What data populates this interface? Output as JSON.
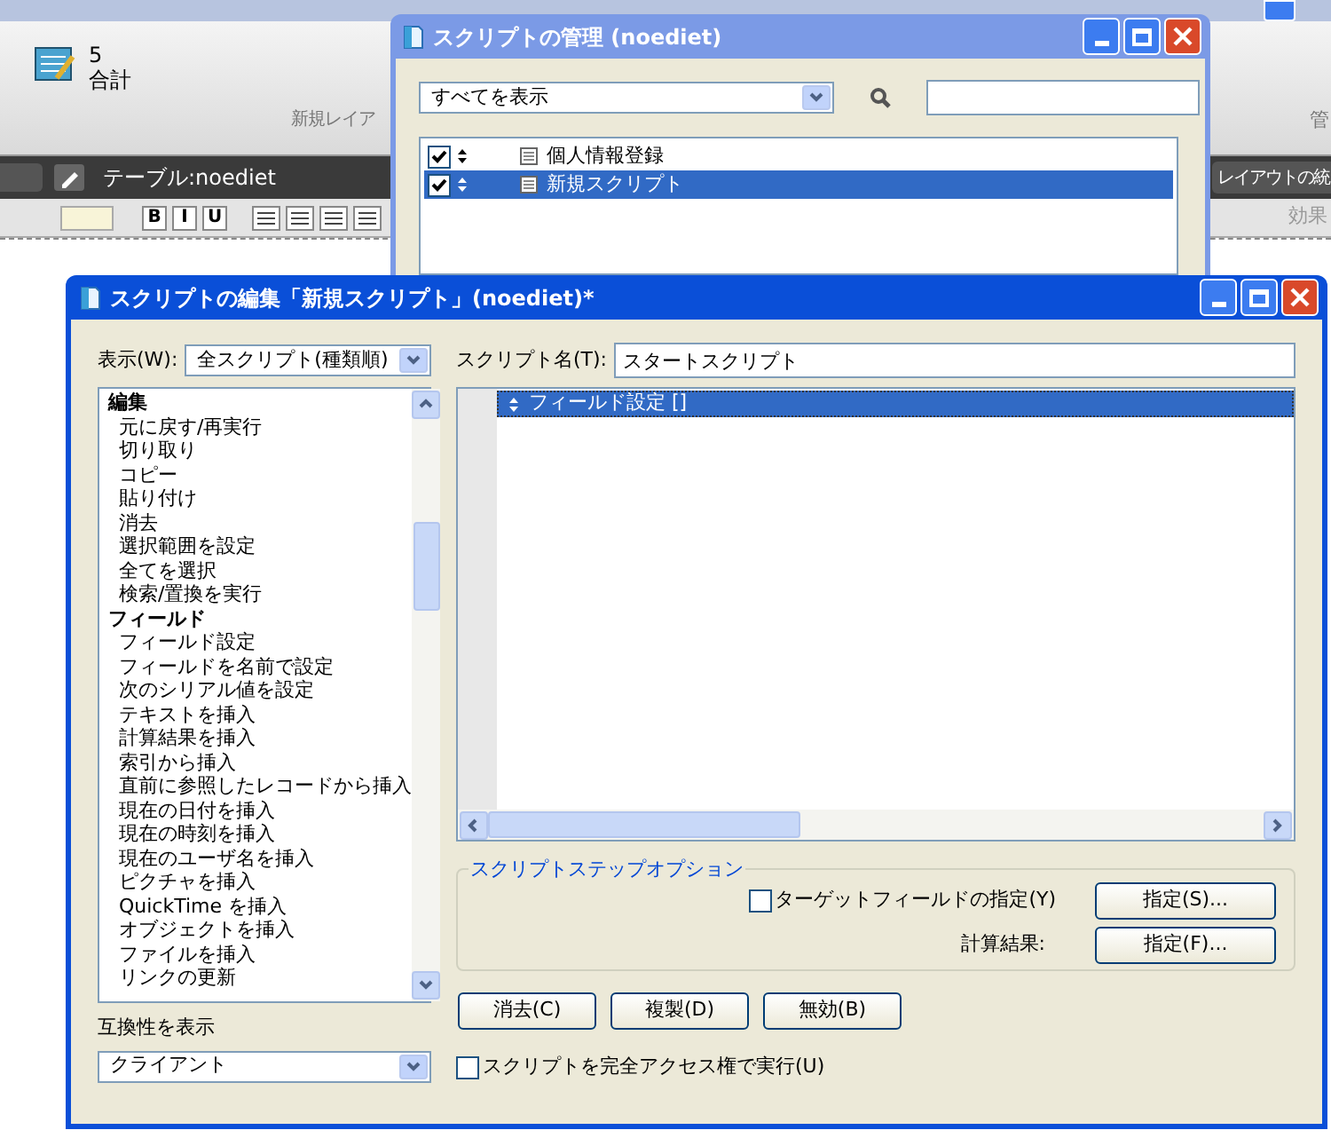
{
  "background_app": {
    "ribbon": {
      "count": "5",
      "count_label": "合計",
      "group_label": "新規レイア",
      "right_label": "管"
    },
    "toolbar": {
      "table_label": "テーブル:noediet",
      "right_button": "レイアウトの統"
    },
    "format_bar": {
      "style_buttons": [
        "B",
        "I",
        "U"
      ],
      "effect_label": "効果"
    }
  },
  "manage_window": {
    "title": "スクリプトの管理 (noediet)",
    "filter": "すべてを表示",
    "scripts": [
      {
        "name": "個人情報登録",
        "checked": true,
        "selected": false
      },
      {
        "name": "新規スクリプト",
        "checked": true,
        "selected": true
      }
    ]
  },
  "edit_window": {
    "title": "スクリプトの編集「新規スクリプト」(noediet)*",
    "view_label": "表示(W):",
    "view_value": "全スクリプト(種類順)",
    "step_list": [
      {
        "label": "編集",
        "kind": "category"
      },
      {
        "label": "元に戻す/再実行",
        "kind": "step"
      },
      {
        "label": "切り取り",
        "kind": "step"
      },
      {
        "label": "コピー",
        "kind": "step"
      },
      {
        "label": "貼り付け",
        "kind": "step"
      },
      {
        "label": "消去",
        "kind": "step"
      },
      {
        "label": "選択範囲を設定",
        "kind": "step"
      },
      {
        "label": "全てを選択",
        "kind": "step"
      },
      {
        "label": "検索/置換を実行",
        "kind": "step"
      },
      {
        "label": "フィールド",
        "kind": "category"
      },
      {
        "label": "フィールド設定",
        "kind": "step"
      },
      {
        "label": "フィールドを名前で設定",
        "kind": "step"
      },
      {
        "label": "次のシリアル値を設定",
        "kind": "step"
      },
      {
        "label": "テキストを挿入",
        "kind": "step"
      },
      {
        "label": "計算結果を挿入",
        "kind": "step"
      },
      {
        "label": "索引から挿入",
        "kind": "step"
      },
      {
        "label": "直前に参照したレコードから挿入",
        "kind": "step"
      },
      {
        "label": "現在の日付を挿入",
        "kind": "step"
      },
      {
        "label": "現在の時刻を挿入",
        "kind": "step"
      },
      {
        "label": "現在のユーザ名を挿入",
        "kind": "step"
      },
      {
        "label": "ピクチャを挿入",
        "kind": "step"
      },
      {
        "label": "QuickTime を挿入",
        "kind": "step"
      },
      {
        "label": "オブジェクトを挿入",
        "kind": "step"
      },
      {
        "label": "ファイルを挿入",
        "kind": "step"
      },
      {
        "label": "リンクの更新",
        "kind": "step"
      }
    ],
    "compat_label": "互換性を表示",
    "compat_value": "クライアント",
    "script_name_label": "スクリプト名(T):",
    "script_name_value": "スタートスクリプト",
    "script_steps": [
      {
        "text": "フィールド設定 []",
        "selected": true
      }
    ],
    "options": {
      "title": "スクリプトステップオプション",
      "target": {
        "label": "ターゲットフィールドの指定(Y)",
        "checked": false
      },
      "target_button": "指定(S)...",
      "calc_label": "計算結果:",
      "calc_button": "指定(F)..."
    },
    "buttons": [
      "消去(C)",
      "複製(D)",
      "無効(B)"
    ],
    "full_access": {
      "label": "スクリプトを完全アクセス権で実行(U)",
      "checked": false
    }
  }
}
